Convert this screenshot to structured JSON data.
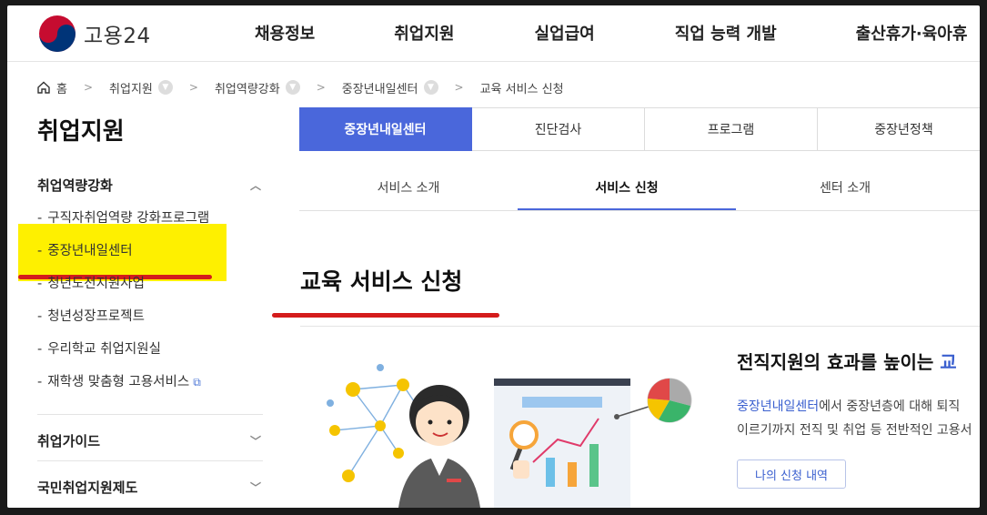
{
  "header": {
    "logo_text": "고용24",
    "nav": [
      "채용정보",
      "취업지원",
      "실업급여",
      "직업 능력 개발",
      "출산휴가·육아휴"
    ]
  },
  "breadcrumb": {
    "home": "홈",
    "items": [
      "취업지원",
      "취업역량강화",
      "중장년내일센터"
    ],
    "current": "교육 서비스 신청"
  },
  "sidebar": {
    "title": "취업지원",
    "group1": "취업역량강화",
    "items": [
      "구직자취업역량 강화프로그램",
      "중장년내일센터",
      "청년도전지원사업",
      "청년성장프로젝트",
      "우리학교 취업지원실",
      "재학생 맞춤형 고용서비스"
    ],
    "group2": "취업가이드",
    "group3": "국민취업지원제도"
  },
  "tabs": [
    "중장년내일센터",
    "진단검사",
    "프로그램",
    "중장년정책"
  ],
  "subtabs": [
    "서비스 소개",
    "서비스 신청",
    "센터 소개"
  ],
  "page_title": "교육 서비스 신청",
  "intro": {
    "heading": "전직지원의 효과를 높이는 ",
    "heading_blue": "교",
    "text_link": "중장년내일센터",
    "text1_rest": "에서 중장년층에 대해 퇴직 ",
    "text2": "이르기까지 전직 및 취업 등 전반적인 고용서",
    "button": "나의 신청 내역"
  },
  "colors": {
    "accent": "#4a67db",
    "highlight": "#fef000",
    "annotation_red": "#d41c1c"
  }
}
